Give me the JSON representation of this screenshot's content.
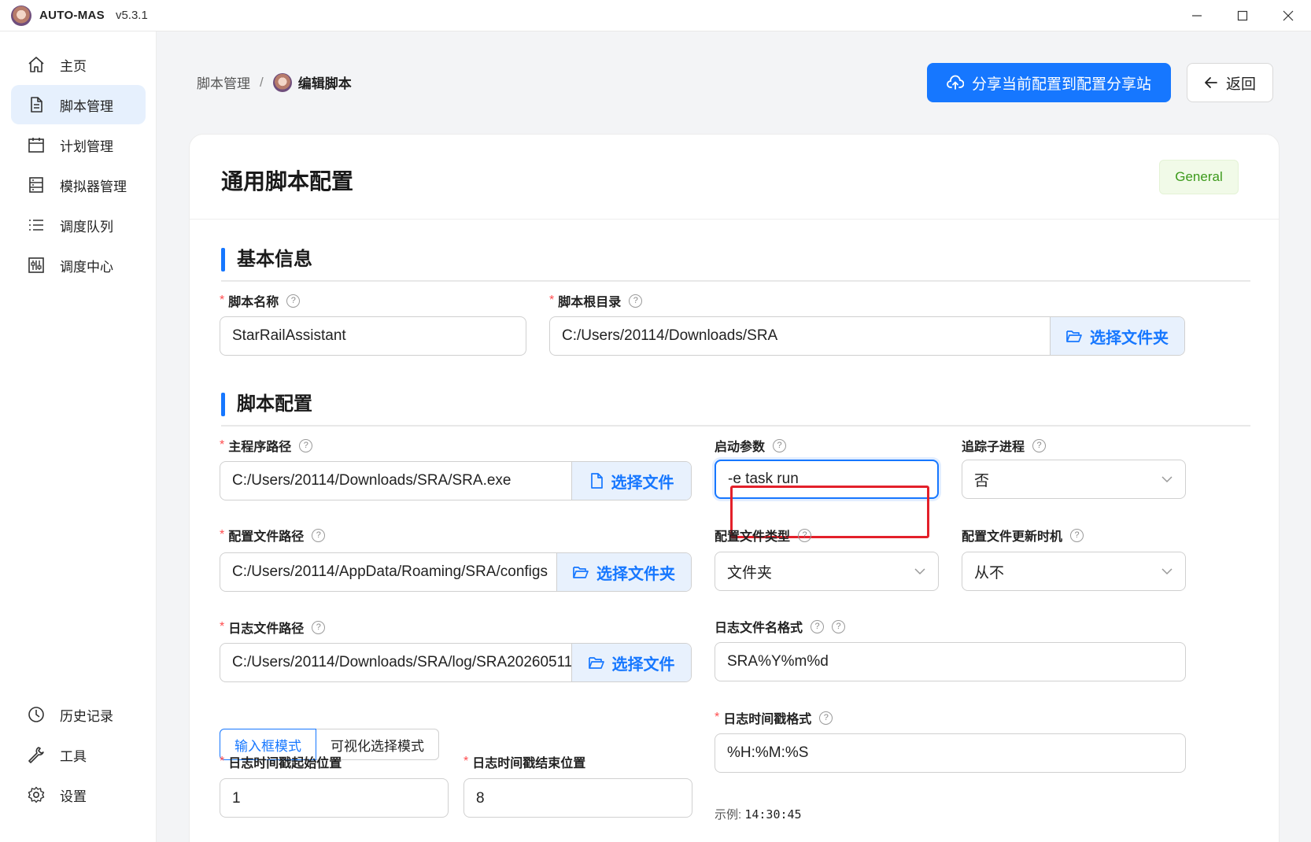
{
  "app": {
    "name": "AUTO-MAS",
    "version": "v5.3.1"
  },
  "window": {
    "minimize": "—",
    "maximize": "☐",
    "close": "✕"
  },
  "sidebar": {
    "items": [
      {
        "label": "主页",
        "icon": "home-icon"
      },
      {
        "label": "脚本管理",
        "icon": "document-icon",
        "active": true
      },
      {
        "label": "计划管理",
        "icon": "calendar-icon"
      },
      {
        "label": "模拟器管理",
        "icon": "database-icon"
      },
      {
        "label": "调度队列",
        "icon": "list-icon"
      },
      {
        "label": "调度中心",
        "icon": "control-icon"
      }
    ],
    "bottom_items": [
      {
        "label": "历史记录",
        "icon": "history-icon"
      },
      {
        "label": "工具",
        "icon": "wrench-icon"
      },
      {
        "label": "设置",
        "icon": "settings-icon"
      }
    ]
  },
  "header": {
    "breadcrumb": {
      "parent": "脚本管理",
      "separator": "/",
      "current": "编辑脚本"
    },
    "share_button": "分享当前配置到配置分享站",
    "back_button": "返回"
  },
  "card": {
    "title": "通用脚本配置",
    "tag": "General",
    "accent_color": "#1677ff",
    "tag_color": "#3c9a1b"
  },
  "basic_info": {
    "section_title": "基本信息",
    "script_name": {
      "label": "脚本名称",
      "value": "StarRailAssistant"
    },
    "script_root": {
      "label": "脚本根目录",
      "value": "C:/Users/20114/Downloads/SRA",
      "button": "选择文件夹"
    }
  },
  "script_config": {
    "section_title": "脚本配置",
    "main_path": {
      "label": "主程序路径",
      "value": "C:/Users/20114/Downloads/SRA/SRA.exe",
      "button": "选择文件"
    },
    "launch_args": {
      "label": "启动参数",
      "value": "-e task run"
    },
    "track_child": {
      "label": "追踪子进程",
      "value": "否"
    },
    "config_path": {
      "label": "配置文件路径",
      "value": "C:/Users/20114/AppData/Roaming/SRA/configs",
      "button": "选择文件夹"
    },
    "config_type": {
      "label": "配置文件类型",
      "value": "文件夹"
    },
    "config_update": {
      "label": "配置文件更新时机",
      "value": "从不"
    },
    "log_path": {
      "label": "日志文件路径",
      "value": "C:/Users/20114/Downloads/SRA/log/SRA20260511",
      "button": "选择文件"
    },
    "log_name_format": {
      "label": "日志文件名格式",
      "value": "SRA%Y%m%d"
    },
    "mode_tabs": {
      "input_mode": "输入框模式",
      "visual_mode": "可视化选择模式"
    },
    "timestamp_format": {
      "label": "日志时间戳格式",
      "value": "%H:%M:%S",
      "example_label": "示例:",
      "example_value": "14:30:45"
    },
    "ts_start": {
      "label": "日志时间戳起始位置",
      "value": "1"
    },
    "ts_end": {
      "label": "日志时间戳结束位置",
      "value": "8"
    }
  }
}
